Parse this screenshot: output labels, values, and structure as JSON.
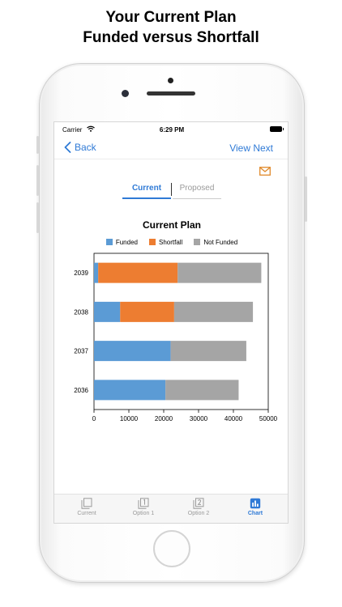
{
  "headline": {
    "line1": "Your Current Plan",
    "line2": "Funded versus Shortfall"
  },
  "status": {
    "carrier": "Carrier",
    "time": "6:29 PM"
  },
  "nav": {
    "back_label": "Back",
    "next_label": "View Next"
  },
  "segmented": {
    "current": "Current",
    "proposed": "Proposed"
  },
  "tabs": [
    {
      "label": "Current",
      "icon": "stacked-pages-icon"
    },
    {
      "label": "Option 1",
      "icon": "page-one-icon"
    },
    {
      "label": "Option 2",
      "icon": "page-two-icon"
    },
    {
      "label": "Chart",
      "icon": "bar-chart-icon"
    }
  ],
  "colors": {
    "accent": "#2f7ad6",
    "funded": "#5b9bd5",
    "shortfall": "#ed7d31",
    "not_funded": "#a5a5a5",
    "mail": "#e08a2c"
  },
  "chart_data": {
    "type": "bar",
    "orientation": "horizontal",
    "stacked": true,
    "title": "Current Plan",
    "categories": [
      "2039",
      "2038",
      "2037",
      "2036"
    ],
    "series": [
      {
        "name": "Funded",
        "color": "#5b9bd5",
        "values": [
          1200,
          7500,
          22000,
          20500
        ]
      },
      {
        "name": "Shortfall",
        "color": "#ed7d31",
        "values": [
          22800,
          15500,
          0,
          0
        ]
      },
      {
        "name": "Not Funded",
        "color": "#a5a5a5",
        "values": [
          24000,
          22600,
          21700,
          21000
        ]
      }
    ],
    "xlim": [
      0,
      50000
    ],
    "xticks": [
      "0",
      "10000",
      "20000",
      "30000",
      "40000",
      "50000"
    ],
    "legend": "top",
    "grid": false
  }
}
